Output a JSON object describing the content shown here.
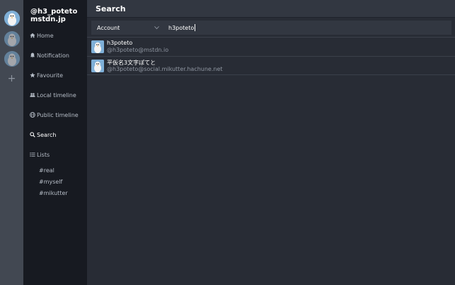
{
  "accounts": [
    {
      "icon": "penguin-avatar-icon",
      "active": true
    },
    {
      "icon": "penguin-avatar-icon",
      "active": false
    },
    {
      "icon": "penguin-avatar-icon",
      "active": false
    }
  ],
  "add_account_label": "+",
  "sidebar": {
    "account_name": "@h3_poteto mstdn.jp",
    "nav": [
      {
        "icon": "home-icon",
        "label": "Home"
      },
      {
        "icon": "bell-icon",
        "label": "Notification"
      },
      {
        "icon": "star-icon",
        "label": "Favourite"
      },
      {
        "icon": "users-icon",
        "label": "Local timeline"
      },
      {
        "icon": "globe-icon",
        "label": "Public timeline"
      },
      {
        "icon": "search-icon",
        "label": "Search",
        "active": true
      },
      {
        "icon": "list-icon",
        "label": "Lists"
      }
    ],
    "lists": [
      "#real",
      "#myself",
      "#mikutter"
    ]
  },
  "main": {
    "title": "Search",
    "search": {
      "type_value": "Account",
      "query": "h3poteto"
    },
    "results": [
      {
        "name": "h3poteto",
        "handle": "@h3poteto@mstdn.io"
      },
      {
        "name": "平仮名3文字ぽてと",
        "handle": "@h3poteto@social.mikutter.hachune.net"
      }
    ]
  },
  "colors": {
    "rail": "#424852",
    "sidebar": "#171a21",
    "main": "#282c35",
    "header": "#323741"
  }
}
